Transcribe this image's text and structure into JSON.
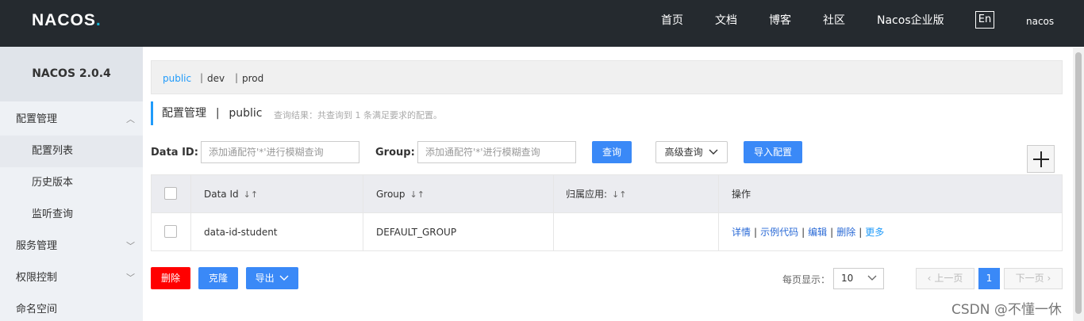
{
  "topnav": {
    "logo": "NACOS",
    "logo_dot": ".",
    "items": [
      "首页",
      "文档",
      "博客",
      "社区",
      "Nacos企业版"
    ],
    "lang": "En",
    "user": "nacos"
  },
  "sidebar": {
    "title": "NACOS 2.0.4",
    "items": [
      {
        "label": "配置管理"
      },
      {
        "label": "配置列表"
      },
      {
        "label": "历史版本"
      },
      {
        "label": "监听查询"
      },
      {
        "label": "服务管理"
      },
      {
        "label": "权限控制"
      },
      {
        "label": "命名空间"
      }
    ]
  },
  "namespaces": {
    "active": "public",
    "others": [
      "dev",
      "prod"
    ],
    "separator": "|"
  },
  "header": {
    "title": "配置管理",
    "separator": "|",
    "namespace": "public",
    "result": "查询结果：共查询到 1 条满足要求的配置。"
  },
  "search": {
    "dataid_label": "Data ID:",
    "dataid_placeholder": "添加通配符'*'进行模糊查询",
    "group_label": "Group:",
    "group_placeholder": "添加通配符'*'进行模糊查询",
    "query_button": "查询",
    "advanced_button": "高级查询",
    "import_button": "导入配置",
    "add_icon": "plus-icon"
  },
  "table": {
    "headers": [
      "Data Id",
      "Group",
      "归属应用:",
      "操作"
    ],
    "sort_icon": "sort-icon",
    "rows": [
      {
        "data_id": "data-id-student",
        "group": "DEFAULT_GROUP",
        "app": "",
        "ops": [
          "详情",
          "示例代码",
          "编辑",
          "删除",
          "更多"
        ]
      }
    ]
  },
  "actions": {
    "delete": "删除",
    "clone": "克隆",
    "export": "导出"
  },
  "pagination": {
    "label": "每页显示：",
    "page_size": "10",
    "prev": "上一页",
    "current": "1",
    "next": "下一页"
  },
  "watermark": "CSDN @不懂一休",
  "colors": {
    "nav_bg": "#252a2f",
    "accent": "#209bfa",
    "primary_button": "#3a89f7",
    "danger_button": "#ff0000"
  }
}
